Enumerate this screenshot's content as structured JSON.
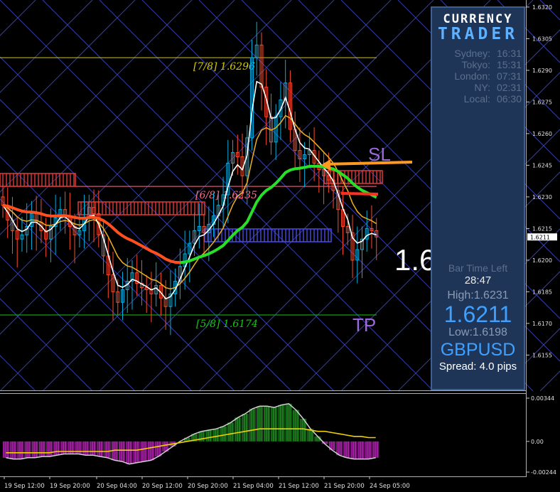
{
  "chart_data": {
    "type": "candlestick",
    "symbol": "GBPUSD",
    "ylim": [
      1.6144,
      1.6322
    ],
    "y_ticks": [
      "1.6320",
      "1.6305",
      "1.6290",
      "1.6275",
      "1.6260",
      "1.6245",
      "1.6230",
      "1.6215",
      "1.6200",
      "1.6185",
      "1.6170",
      "1.6155"
    ],
    "current_price_tag": "1.6211",
    "x_ticks": [
      "19 Sep 12:00",
      "19 Sep 20:00",
      "20 Sep 04:00",
      "20 Sep 12:00",
      "20 Sep 20:00",
      "21 Sep 04:00",
      "21 Sep 12:00",
      "21 Sep 20:00",
      "24 Sep 05:00"
    ],
    "murrey_levels": [
      {
        "label": "[7/8]  1.6296",
        "value": 1.6296,
        "color": "#d6c800"
      },
      {
        "label": "[6/8]  1.6235",
        "value": 1.6235,
        "color": "#ff6f8a"
      },
      {
        "label": "[5/8]  1.6174",
        "value": 1.6174,
        "color": "#10c810"
      }
    ],
    "annotations": {
      "sl": "SL",
      "tp": "TP",
      "big_price": "1.6"
    },
    "closes": [
      1.6226,
      1.6219,
      1.6214,
      1.621,
      1.6212,
      1.6216,
      1.6222,
      1.6218,
      1.6214,
      1.621,
      1.6216,
      1.622,
      1.6224,
      1.6221,
      1.6216,
      1.6212,
      1.6214,
      1.622,
      1.6225,
      1.6222,
      1.6212,
      1.6202,
      1.6193,
      1.6185,
      1.618,
      1.6186,
      1.619,
      1.6194,
      1.6189,
      1.6187,
      1.6186,
      1.6184,
      1.6188,
      1.6182,
      1.6178,
      1.6184,
      1.619,
      1.6197,
      1.6203,
      1.6208,
      1.6214,
      1.6216,
      1.6213,
      1.6217,
      1.6221,
      1.6226,
      1.6231,
      1.6246,
      1.6251,
      1.6249,
      1.624,
      1.6258,
      1.6296,
      1.6302,
      1.6282,
      1.6268,
      1.6256,
      1.6268,
      1.6276,
      1.6284,
      1.6262,
      1.6252,
      1.6248,
      1.625,
      1.6252,
      1.6246,
      1.6243,
      1.624,
      1.6238,
      1.6233,
      1.6224,
      1.6216,
      1.6213,
      1.62,
      1.6205,
      1.621,
      1.6215,
      1.6214,
      1.6211
    ],
    "oscillator": {
      "ylim": [
        -0.00244,
        0.00344
      ],
      "y_ticks": [
        "0.00344",
        "0.00",
        "-0.00244"
      ],
      "values": [
        -0.0013,
        -0.0014,
        -0.0014,
        -0.0013,
        -0.0013,
        -0.0012,
        -0.0012,
        -0.0011,
        -0.001,
        -0.001,
        -0.001,
        -0.0011,
        -0.0011,
        -0.0012,
        -0.0013,
        -0.0015,
        -0.0016,
        -0.0018,
        -0.0017,
        -0.0016,
        -0.0015,
        -0.0012,
        -0.0008,
        -0.0004,
        0.0,
        0.0003,
        0.0006,
        0.0008,
        0.0009,
        0.001,
        0.0012,
        0.0015,
        0.0019,
        0.0022,
        0.0026,
        0.0028,
        0.0028,
        0.0027,
        0.0029,
        0.003,
        0.0025,
        0.0018,
        0.001,
        0.0004,
        -0.0002,
        -0.0007,
        -0.0011,
        -0.0013,
        -0.0014,
        -0.0014,
        -0.0014,
        -0.0013
      ],
      "signal": [
        -0.0009,
        -0.0009,
        -0.0009,
        -0.0009,
        -0.0009,
        -0.0009,
        -0.0009,
        -0.0008,
        -0.0008,
        -0.0008,
        -0.0008,
        -0.0008,
        -0.0008,
        -0.0008,
        -0.0008,
        -0.0007,
        -0.0007,
        -0.0007,
        -0.0007,
        -0.0006,
        -0.0005,
        -0.0004,
        -0.0003,
        -0.0002,
        -0.0001,
        0.0,
        0.0001,
        0.0002,
        0.0003,
        0.0004,
        0.0005,
        0.0006,
        0.0007,
        0.0008,
        0.0009,
        0.001,
        0.001,
        0.001,
        0.001,
        0.001,
        0.001,
        0.001,
        0.0009,
        0.0008,
        0.0008,
        0.0007,
        0.0006,
        0.0005,
        0.0004,
        0.0004,
        0.0003,
        0.0003
      ]
    }
  },
  "panel": {
    "title1": "CURRENCY",
    "title2": "TRADER",
    "sessions": [
      {
        "city": "Sydney:",
        "time": "16:31"
      },
      {
        "city": "Tokyo:",
        "time": "15:31"
      },
      {
        "city": "London:",
        "time": "07:31"
      },
      {
        "city": "NY:",
        "time": "02:31"
      },
      {
        "city": "Local:",
        "time": "06:30"
      }
    ],
    "bar_time_label": "Bar Time Left",
    "bar_time": "28:47",
    "high": "High:1.6231",
    "price": "1.6211",
    "low": "Low:1.6198",
    "symbol": "GBPUSD",
    "spread": "Spread: 4.0 pips"
  },
  "colors": {
    "bull": "#00b0e0",
    "bear": "#ff4a2a",
    "ma_fast": "#ffffff",
    "ma_mid": "#f0b020",
    "ma_slow_down": "#ff5020",
    "ma_slow_up": "#28e028",
    "grid_lines": "#3c48c8",
    "osc_pos": "#1e7a1e",
    "osc_neg": "#a020a0",
    "signal": "#f0d000"
  }
}
